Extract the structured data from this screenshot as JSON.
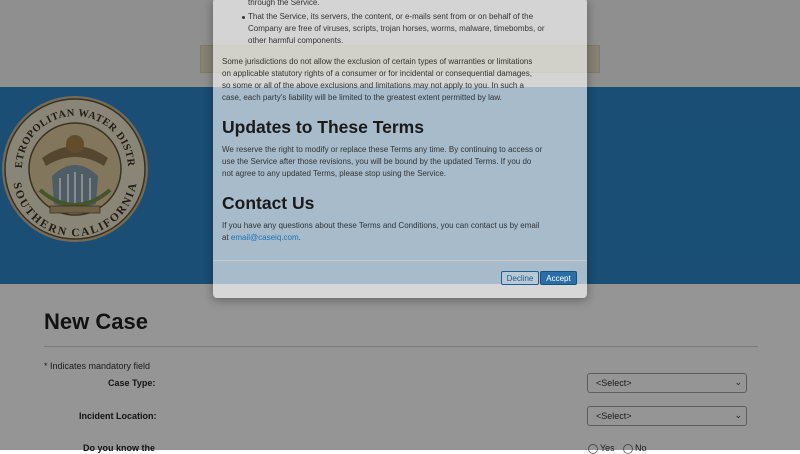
{
  "form": {
    "title": "New Case",
    "mandatory_note": "* Indicates mandatory field",
    "case_type_label": "Case Type:",
    "case_type_value": "<Select>",
    "incident_location_label": "Incident Location:",
    "incident_location_value": "<Select>",
    "know_label": "Do you know the",
    "yes_label": "Yes",
    "no_label": "No"
  },
  "modal": {
    "bullet1_tail": "through the Service.",
    "bullet2_lines": [
      "That the Service, its servers, the content, or e-mails sent from or on behalf of the",
      "Company are free of viruses, scripts, trojan horses, worms, malware, timebombs, or",
      "other harmful components."
    ],
    "jurisdiction_lines": [
      "Some jurisdictions do not allow the exclusion of certain types of warranties or limitations",
      "on applicable statutory rights of a consumer or for incidental or consequential damages,",
      "so some or all of the above exclusions and limitations may not apply to you. In such a",
      "case, each party's liability will be limited to the greatest extent permitted by law."
    ],
    "updates_heading": "Updates to These Terms",
    "updates_lines": [
      "We reserve the right to modify or replace these Terms any time. By continuing to access or",
      "use the Service after those revisions, you will be bound by the updated Terms. If you do",
      "not agree to any updated Terms, please stop using the Service."
    ],
    "contact_heading": "Contact Us",
    "contact_line1": "If you have any questions about these Terms and Conditions, you can contact us by email",
    "contact_at": "at ",
    "contact_email": "email@caseiq.com",
    "contact_period": ".",
    "decline_label": "Decline",
    "accept_label": "Accept"
  },
  "seal": {
    "top_text": "THE METROPOLITAN WATER DISTRICT OF",
    "bottom_text": "SOUTHERN CALIFORNIA"
  },
  "colors": {
    "banner": "#1f7fc4",
    "link": "#1a73b8",
    "accept_button": "#2a6ea5"
  }
}
